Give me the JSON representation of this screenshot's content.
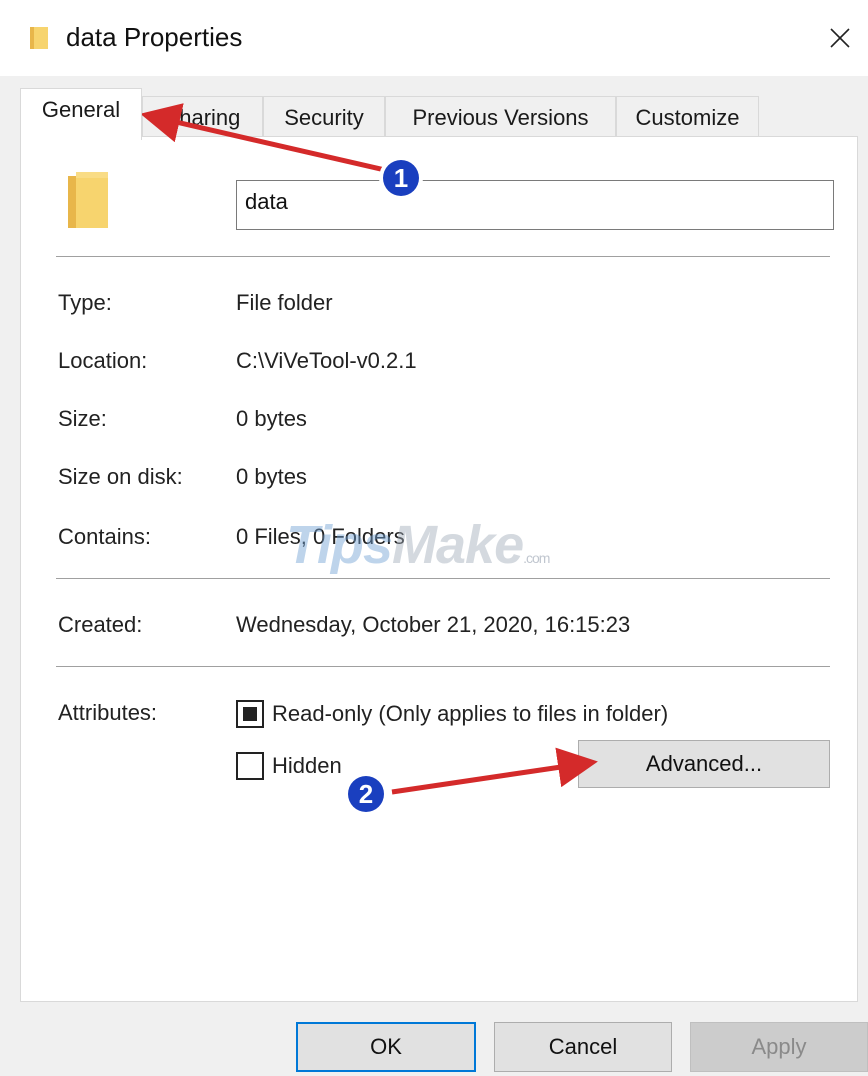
{
  "window": {
    "title": "data Properties",
    "close_icon": "close-icon"
  },
  "tabs": [
    {
      "label": "General",
      "active": true
    },
    {
      "label": "Sharing"
    },
    {
      "label": "Security"
    },
    {
      "label": "Previous Versions"
    },
    {
      "label": "Customize"
    }
  ],
  "general": {
    "name_value": "data",
    "type_label": "Type:",
    "type_value": "File folder",
    "location_label": "Location:",
    "location_value": "C:\\ViVeTool-v0.2.1",
    "size_label": "Size:",
    "size_value": "0 bytes",
    "size_on_disk_label": "Size on disk:",
    "size_on_disk_value": "0 bytes",
    "contains_label": "Contains:",
    "contains_value": "0 Files, 0 Folders",
    "created_label": "Created:",
    "created_value": "Wednesday, October 21, 2020, 16:15:23",
    "attributes_label": "Attributes:",
    "readonly_label": "Read-only (Only applies to files in folder)",
    "readonly_state": "indeterminate",
    "hidden_label": "Hidden",
    "hidden_checked": false,
    "advanced_button": "Advanced..."
  },
  "footer": {
    "ok": "OK",
    "cancel": "Cancel",
    "apply": "Apply",
    "apply_enabled": false
  },
  "watermark": {
    "part1": "Tips",
    "part2": "Make",
    "suffix": ".com"
  },
  "annotations": [
    {
      "number": "1"
    },
    {
      "number": "2"
    }
  ],
  "colors": {
    "annotation_arrow": "#d42a2a",
    "annotation_badge": "#1a3fbf",
    "folder": "#f5cf6b",
    "accent": "#0078d7"
  }
}
